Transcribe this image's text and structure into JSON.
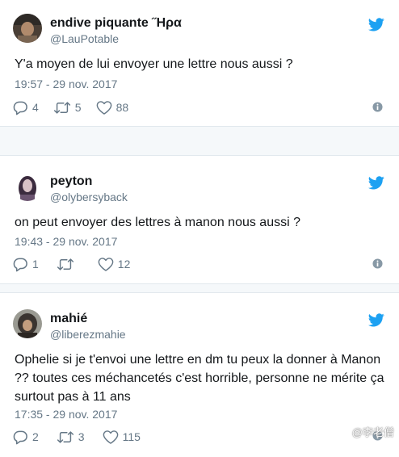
{
  "tweets": [
    {
      "display_name": "endive piquante ˝Ηρα",
      "handle": "@LauPotable",
      "text": "Y'a moyen de lui envoyer une lettre nous aussi ?",
      "timestamp": "19:57 - 29 nov. 2017",
      "replies": "4",
      "retweets": "5",
      "likes": "88"
    },
    {
      "display_name": "peyton",
      "handle": "@olybersyback",
      "text": "on peut envoyer des lettres à manon nous aussi ?",
      "timestamp": "19:43 - 29 nov. 2017",
      "replies": "1",
      "retweets": "",
      "likes": "12"
    },
    {
      "display_name": "mahié",
      "handle": "@liberezmahie",
      "text": "Ophelie si je t'envoi une lettre en dm tu peux la donner à Manon ?? toutes ces méchancetés c'est horrible, personne ne mérite ça surtout pas à 11 ans",
      "timestamp": "17:35 - 29 nov. 2017",
      "replies": "2",
      "retweets": "3",
      "likes": "115"
    }
  ],
  "icons": {
    "bird": "twitter-bird-icon",
    "reply": "reply-icon",
    "retweet": "retweet-icon",
    "like": "heart-icon",
    "info": "info-icon"
  },
  "colors": {
    "twitter_blue": "#1da1f2",
    "secondary_text": "#657786",
    "border": "#e1e8ed",
    "background_gap": "#f5f8fa"
  },
  "watermark": {
    "text": "@李老僧"
  }
}
